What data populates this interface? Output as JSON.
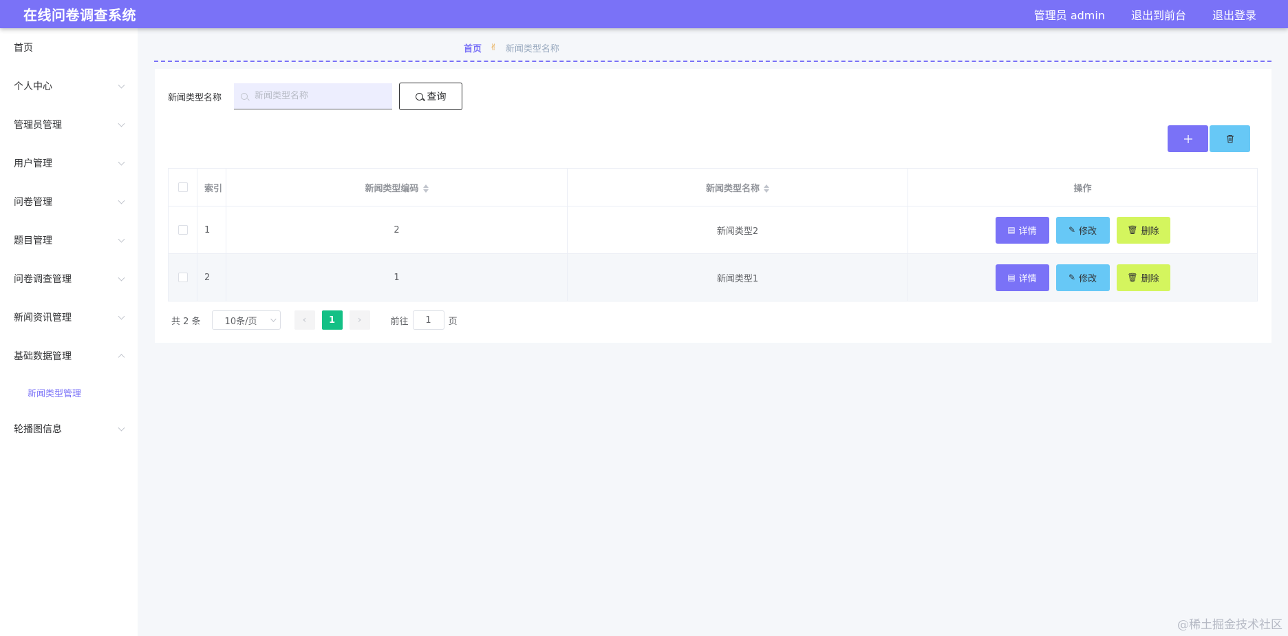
{
  "header": {
    "title": "在线问卷调查系统",
    "admin_label": "管理员 admin",
    "front_label": "退出到前台",
    "logout_label": "退出登录"
  },
  "sidebar": {
    "items": [
      {
        "label": "首页"
      },
      {
        "label": "个人中心"
      },
      {
        "label": "管理员管理"
      },
      {
        "label": "用户管理"
      },
      {
        "label": "问卷管理"
      },
      {
        "label": "题目管理"
      },
      {
        "label": "问卷调查管理"
      },
      {
        "label": "新闻资讯管理"
      },
      {
        "label": "基础数据管理"
      },
      {
        "label": "轮播图信息"
      }
    ],
    "submenu": {
      "label": "新闻类型管理"
    }
  },
  "breadcrumb": {
    "home": "首页",
    "separator": "✌",
    "current": "新闻类型名称"
  },
  "search": {
    "label": "新闻类型名称",
    "placeholder": "新闻类型名称",
    "value": "",
    "button": "查询"
  },
  "toolbar": {
    "add_icon": "plus-icon",
    "delete_icon": "trash-icon"
  },
  "table": {
    "headers": {
      "index": "索引",
      "code": "新闻类型编码",
      "name": "新闻类型名称",
      "ops": "操作"
    },
    "rows": [
      {
        "index": "1",
        "code": "2",
        "name": "新闻类型2"
      },
      {
        "index": "2",
        "code": "1",
        "name": "新闻类型1"
      }
    ],
    "actions": {
      "detail": "详情",
      "edit": "修改",
      "remove": "删除"
    }
  },
  "pagination": {
    "total": "共 2 条",
    "page_size": "10条/页",
    "current_page": "1",
    "goto_label": "前往",
    "goto_value": "1",
    "page_unit": "页"
  },
  "watermark": "@稀土掘金技术社区",
  "colors": {
    "primary": "#7a72f7",
    "info": "#67c8f6",
    "lime": "#d4f55e",
    "pager_active": "#13c085"
  }
}
